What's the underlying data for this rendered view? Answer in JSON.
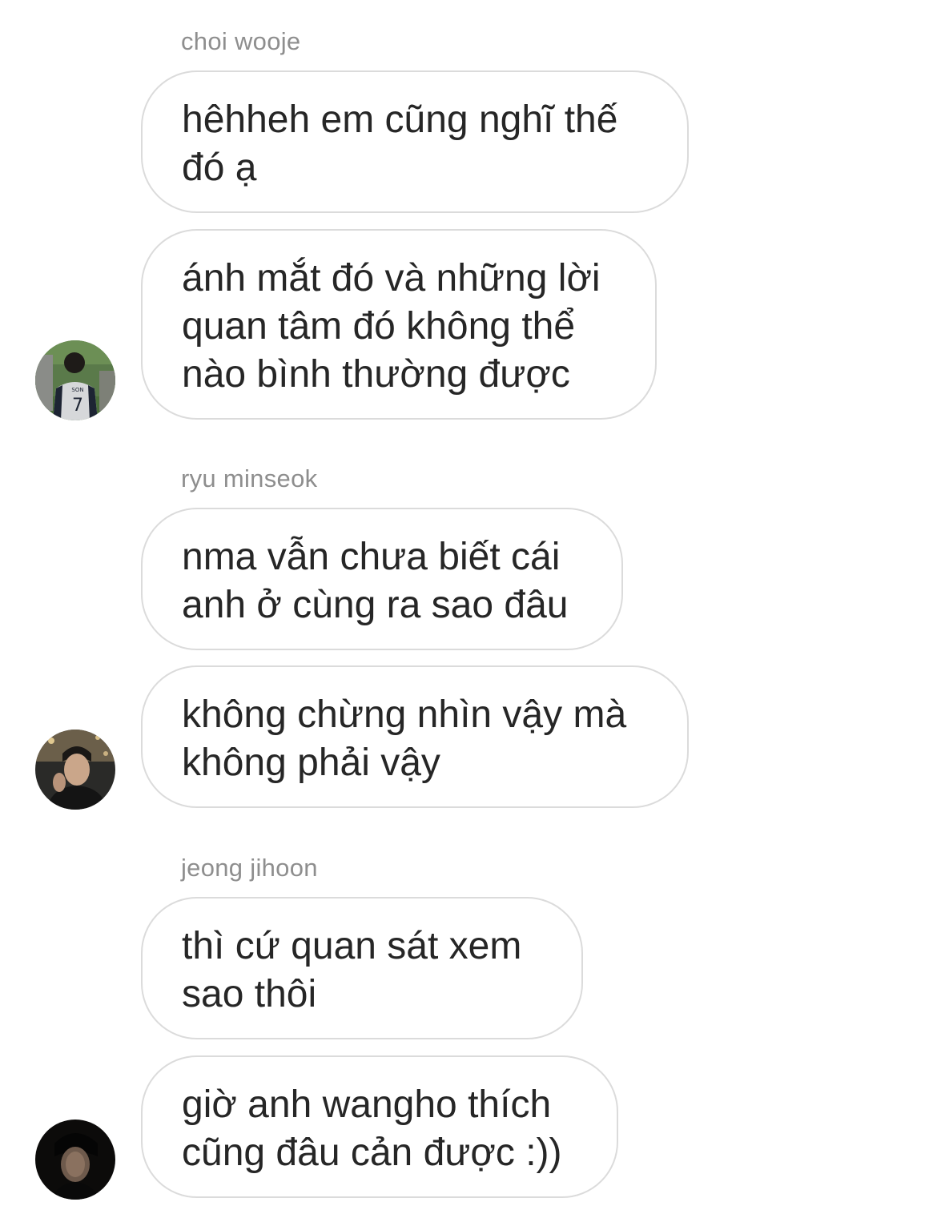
{
  "groups": [
    {
      "sender": "choi wooje",
      "messages": [
        "hêhheh em cũng nghĩ thế\nđó ạ",
        "ánh mắt đó và những lời\nquan tâm đó không thể\nnào bình thường được"
      ],
      "avatar": {
        "icon": "avatar-stadium-photo",
        "jersey_name": "SON",
        "jersey_number": "7"
      }
    },
    {
      "sender": "ryu minseok",
      "messages": [
        "nma vẫn chưa biết cái\nanh ở cùng ra sao đâu",
        "không chừng nhìn vậy mà\nkhông phải vậy"
      ],
      "avatar": {
        "icon": "avatar-portrait-photo"
      }
    },
    {
      "sender": "jeong jihoon",
      "messages": [
        "thì cứ quan sát xem\nsao thôi",
        "giờ anh wangho thích\ncũng đâu cản được :))"
      ],
      "avatar": {
        "icon": "avatar-dark-portrait-photo"
      }
    }
  ],
  "colors": {
    "bubble_border": "#dbdbdb",
    "sender_text": "#8e8e8e",
    "message_text": "#262626",
    "background": "#ffffff"
  }
}
